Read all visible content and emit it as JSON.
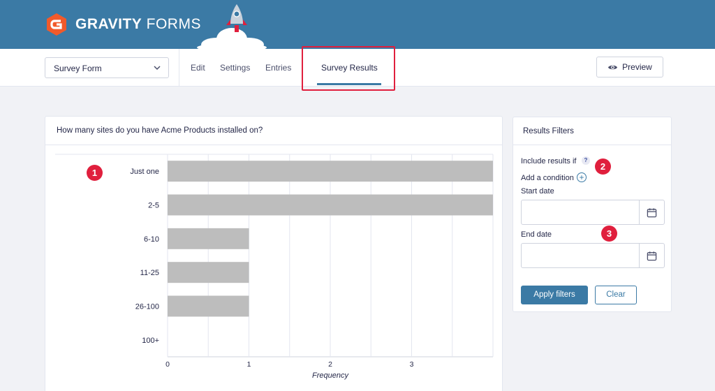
{
  "header": {
    "logo_bold": "GRAVITY",
    "logo_thin": " FORMS",
    "brand_color": "#3b7aa5"
  },
  "toolbar": {
    "form_select_value": "Survey Form",
    "tabs": [
      {
        "label": "Edit"
      },
      {
        "label": "Settings"
      },
      {
        "label": "Entries"
      },
      {
        "label": "Survey Results"
      }
    ],
    "preview_label": "Preview"
  },
  "chart_panel": {
    "title": "How many sites do you have Acme Products installed on?"
  },
  "chart_data": {
    "type": "bar",
    "orientation": "horizontal",
    "categories": [
      "Just one",
      "2-5",
      "6-10",
      "11-25",
      "26-100",
      "100+"
    ],
    "values": [
      4,
      4,
      1,
      1,
      1,
      0
    ],
    "xlabel": "Frequency",
    "ylabel": "",
    "xlim": [
      0,
      4
    ],
    "xticks": [
      "0",
      "1",
      "2",
      "3"
    ],
    "grid": true,
    "bar_color": "#bdbdbd"
  },
  "filters": {
    "title": "Results Filters",
    "include_label": "Include results if",
    "help_glyph": "?",
    "add_condition": "Add a condition",
    "plus_glyph": "+",
    "start_date_label": "Start date",
    "start_date_value": "",
    "end_date_label": "End date",
    "end_date_value": "",
    "apply_label": "Apply filters",
    "clear_label": "Clear"
  },
  "callouts": [
    "1",
    "2",
    "3"
  ],
  "highlight_color": "#e01f3d"
}
